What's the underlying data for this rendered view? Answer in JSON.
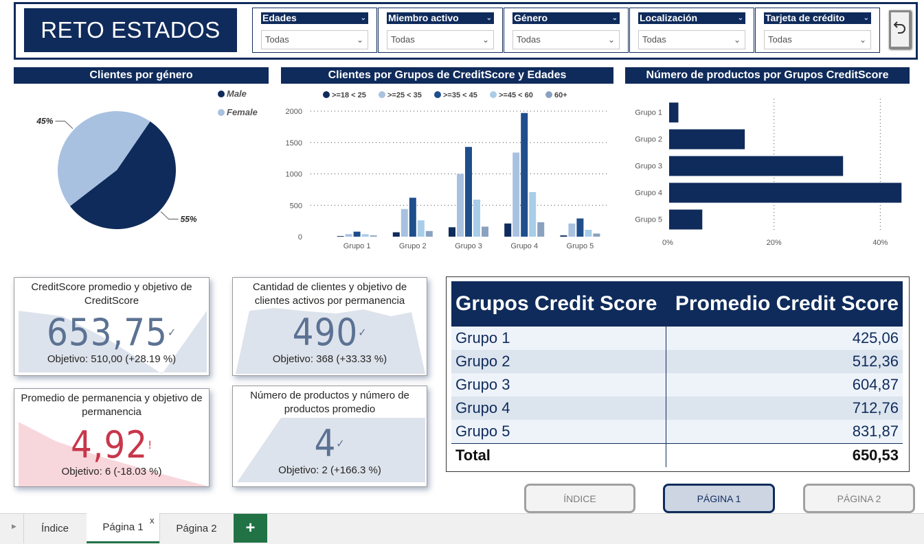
{
  "header": {
    "title": "RETO ESTADOS",
    "slicers": [
      {
        "label": "Edades",
        "value": "Todas"
      },
      {
        "label": "Miembro activo",
        "value": "Todas"
      },
      {
        "label": "Género",
        "value": "Todas"
      },
      {
        "label": "Localización",
        "value": "Todas"
      },
      {
        "label": "Tarjeta de crédito",
        "value": "Todas"
      }
    ],
    "back_icon": "back-arrow-icon"
  },
  "colors": {
    "navy": "#0f2b5b",
    "light_blue": "#a9c1e0",
    "mid_blue": "#1f4e8c",
    "pale_blue": "#a8cde8",
    "steel": "#8aa2c0",
    "red": "#c8374a",
    "kpi_blue": "#5b7293"
  },
  "gender_chart": {
    "title": "Clientes por género",
    "chart_data": {
      "type": "pie",
      "labels": [
        "Male",
        "Female"
      ],
      "values": [
        55,
        45
      ],
      "value_labels": [
        "55%",
        "45%"
      ],
      "colors": [
        "#0f2b5b",
        "#a9c1e0"
      ],
      "legend": "top-right"
    }
  },
  "credit_age_chart": {
    "title": "Clientes por Grupos de CreditScore y Edades",
    "chart_data": {
      "type": "bar",
      "categories": [
        "Grupo 1",
        "Grupo 2",
        "Grupo 3",
        "Grupo 4",
        "Grupo 5"
      ],
      "series": [
        {
          "name": ">=18 < 25",
          "values": [
            10,
            70,
            150,
            210,
            20
          ],
          "color": "#0f2b5b"
        },
        {
          "name": ">=25 < 35",
          "values": [
            40,
            440,
            1000,
            1340,
            210
          ],
          "color": "#a9c1e0"
        },
        {
          "name": ">=35 < 45",
          "values": [
            80,
            620,
            1430,
            1970,
            290
          ],
          "color": "#1f4e8c"
        },
        {
          "name": ">=45 < 60",
          "values": [
            40,
            260,
            590,
            710,
            110
          ],
          "color": "#a8cde8"
        },
        {
          "name": "60+",
          "values": [
            20,
            90,
            160,
            230,
            50
          ],
          "color": "#8aa2c0"
        }
      ],
      "yticks": [
        "0",
        "500",
        "1000",
        "1500",
        "2000"
      ],
      "ylim": [
        0,
        2000
      ],
      "legend": "top"
    }
  },
  "products_chart": {
    "title": "Número de productos por Grupos CreditScore",
    "chart_data": {
      "type": "bar",
      "orientation": "horizontal",
      "categories": [
        "Grupo 1",
        "Grupo 2",
        "Grupo 3",
        "Grupo 4",
        "Grupo 5"
      ],
      "values": [
        2,
        14.5,
        33,
        44,
        6.5
      ],
      "unit": "%",
      "xticks": [
        "0%",
        "20%",
        "40%"
      ],
      "xlim": [
        0,
        45
      ],
      "color": "#0f2b5b"
    }
  },
  "kpis": [
    {
      "title": "CreditScore promedio y objetivo de CreditScore",
      "value": "653,75",
      "mark": "✓",
      "goal": "Objetivo: 510,00 (+28.19 %)",
      "color": "#5b7293"
    },
    {
      "title": "Cantidad de clientes y objetivo de clientes activos por permanencia",
      "value": "490",
      "mark": "✓",
      "goal": "Objetivo: 368 (+33.33 %)",
      "color": "#5b7293"
    },
    {
      "title": "Promedio de permanencia y objetivo de permanencia",
      "value": "4,92",
      "mark": "!",
      "goal": "Objetivo: 6 (-18.03 %)",
      "color": "#c8374a"
    },
    {
      "title": "Número de productos y número de productos promedio",
      "value": "4",
      "mark": "✓",
      "goal": "Objetivo: 2 (+166.3 %)",
      "color": "#5b7293"
    }
  ],
  "score_table": {
    "headers": [
      "Grupos Credit Score",
      "Promedio Credit Score"
    ],
    "rows": [
      [
        "Grupo 1",
        "425,06"
      ],
      [
        "Grupo 2",
        "512,36"
      ],
      [
        "Grupo 3",
        "604,87"
      ],
      [
        "Grupo 4",
        "712,76"
      ],
      [
        "Grupo 5",
        "831,87"
      ]
    ],
    "total": [
      "Total",
      "650,53"
    ]
  },
  "nav_buttons": {
    "index": "ÍNDICE",
    "page1": "PÁGINA 1",
    "page2": "PÁGINA 2"
  },
  "tabs": {
    "items": [
      "Índice",
      "Página 1",
      "Página 2"
    ],
    "active": "Página 1",
    "close": "x",
    "add": "+"
  }
}
